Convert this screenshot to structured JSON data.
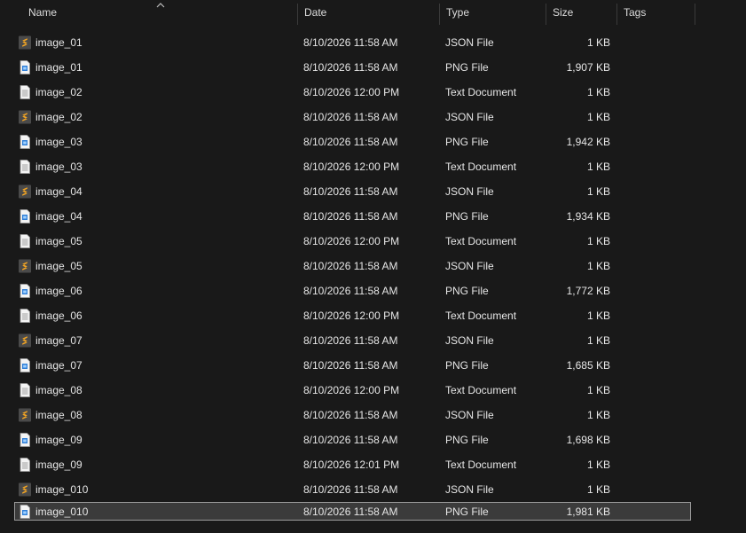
{
  "columns": {
    "name": "Name",
    "date": "Date",
    "type": "Type",
    "size": "Size",
    "tags": "Tags"
  },
  "colors": {
    "background": "#191919",
    "selection": "#3b3b3b",
    "json_icon": "#f5a623",
    "png_icon": "#2f7fd8"
  },
  "files": [
    {
      "name": "image_01",
      "date": "8/10/2026 11:58 AM",
      "type": "JSON File",
      "size": "1 KB",
      "icon": "json-file-icon"
    },
    {
      "name": "image_01",
      "date": "8/10/2026 11:58 AM",
      "type": "PNG File",
      "size": "1,907 KB",
      "icon": "png-file-icon"
    },
    {
      "name": "image_02",
      "date": "8/10/2026 12:00 PM",
      "type": "Text Document",
      "size": "1 KB",
      "icon": "text-file-icon"
    },
    {
      "name": "image_02",
      "date": "8/10/2026 11:58 AM",
      "type": "JSON File",
      "size": "1 KB",
      "icon": "json-file-icon"
    },
    {
      "name": "image_03",
      "date": "8/10/2026 11:58 AM",
      "type": "PNG File",
      "size": "1,942 KB",
      "icon": "png-file-icon"
    },
    {
      "name": "image_03",
      "date": "8/10/2026 12:00 PM",
      "type": "Text Document",
      "size": "1 KB",
      "icon": "text-file-icon"
    },
    {
      "name": "image_04",
      "date": "8/10/2026 11:58 AM",
      "type": "JSON File",
      "size": "1 KB",
      "icon": "json-file-icon"
    },
    {
      "name": "image_04",
      "date": "8/10/2026 11:58 AM",
      "type": "PNG File",
      "size": "1,934 KB",
      "icon": "png-file-icon"
    },
    {
      "name": "image_05",
      "date": "8/10/2026 12:00 PM",
      "type": "Text Document",
      "size": "1 KB",
      "icon": "text-file-icon"
    },
    {
      "name": "image_05",
      "date": "8/10/2026 11:58 AM",
      "type": "JSON File",
      "size": "1 KB",
      "icon": "json-file-icon"
    },
    {
      "name": "image_06",
      "date": "8/10/2026 11:58 AM",
      "type": "PNG File",
      "size": "1,772 KB",
      "icon": "png-file-icon"
    },
    {
      "name": "image_06",
      "date": "8/10/2026 12:00 PM",
      "type": "Text Document",
      "size": "1 KB",
      "icon": "text-file-icon"
    },
    {
      "name": "image_07",
      "date": "8/10/2026 11:58 AM",
      "type": "JSON File",
      "size": "1 KB",
      "icon": "json-file-icon"
    },
    {
      "name": "image_07",
      "date": "8/10/2026 11:58 AM",
      "type": "PNG File",
      "size": "1,685 KB",
      "icon": "png-file-icon"
    },
    {
      "name": "image_08",
      "date": "8/10/2026 12:00 PM",
      "type": "Text Document",
      "size": "1 KB",
      "icon": "text-file-icon"
    },
    {
      "name": "image_08",
      "date": "8/10/2026 11:58 AM",
      "type": "JSON File",
      "size": "1 KB",
      "icon": "json-file-icon"
    },
    {
      "name": "image_09",
      "date": "8/10/2026 11:58 AM",
      "type": "PNG File",
      "size": "1,698 KB",
      "icon": "png-file-icon"
    },
    {
      "name": "image_09",
      "date": "8/10/2026 12:01 PM",
      "type": "Text Document",
      "size": "1 KB",
      "icon": "text-file-icon"
    },
    {
      "name": "image_010",
      "date": "8/10/2026 11:58 AM",
      "type": "JSON File",
      "size": "1 KB",
      "icon": "json-file-icon"
    },
    {
      "name": "image_010",
      "date": "8/10/2026 11:58 AM",
      "type": "PNG File",
      "size": "1,981 KB",
      "icon": "png-file-icon",
      "selected": true
    }
  ]
}
